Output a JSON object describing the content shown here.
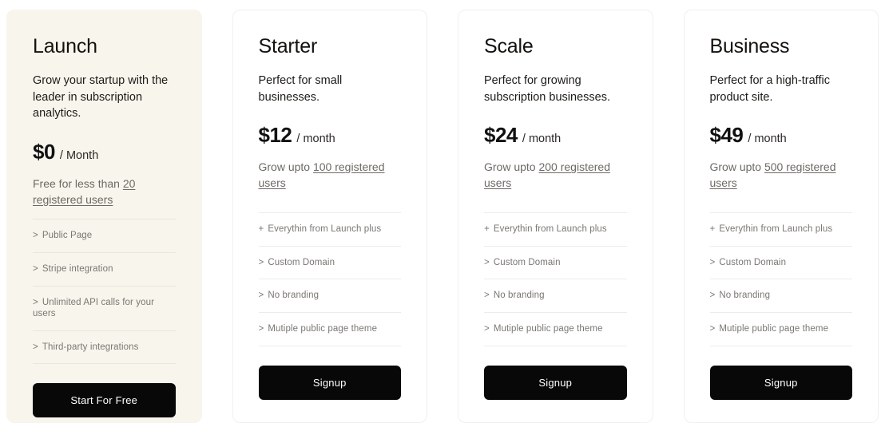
{
  "colors": {
    "page_background": "#ffffff",
    "featured_card_background": "#f8f5ed",
    "card_border": "#f0f0f0",
    "button_background": "#080808",
    "button_text": "#ffffff",
    "title_text": "#14110e",
    "muted_text": "#6d6a64",
    "feature_text": "#7a7772",
    "divider": "#e9e6df"
  },
  "plans": [
    {
      "id": "launch",
      "featured": true,
      "title": "Launch",
      "tagline": "Grow your startup with the leader in subscription analytics.",
      "price_amount": "$0",
      "price_period": "/ Month",
      "grow_prefix": "Free for less than ",
      "grow_link": "20 registered users",
      "features": [
        {
          "marker": ">",
          "label": "Public Page"
        },
        {
          "marker": ">",
          "label": "Stripe integration"
        },
        {
          "marker": ">",
          "label": "Unlimited API calls for your users"
        },
        {
          "marker": ">",
          "label": "Third-party integrations"
        }
      ],
      "cta_label": "Start For Free"
    },
    {
      "id": "starter",
      "featured": false,
      "title": "Starter",
      "tagline": "Perfect for small businesses.",
      "price_amount": "$12",
      "price_period": "/ month",
      "grow_prefix": "Grow upto ",
      "grow_link": "100 registered users",
      "features": [
        {
          "marker": "+",
          "label": "Everythin from Launch plus"
        },
        {
          "marker": ">",
          "label": "Custom Domain"
        },
        {
          "marker": ">",
          "label": "No branding"
        },
        {
          "marker": ">",
          "label": "Mutiple public page theme"
        }
      ],
      "cta_label": "Signup"
    },
    {
      "id": "scale",
      "featured": false,
      "title": "Scale",
      "tagline": "Perfect for growing subscription businesses.",
      "price_amount": "$24",
      "price_period": "/ month",
      "grow_prefix": "Grow upto ",
      "grow_link": "200 registered users",
      "features": [
        {
          "marker": "+",
          "label": "Everythin from Launch plus"
        },
        {
          "marker": ">",
          "label": "Custom Domain"
        },
        {
          "marker": ">",
          "label": "No branding"
        },
        {
          "marker": ">",
          "label": "Mutiple public page theme"
        }
      ],
      "cta_label": "Signup"
    },
    {
      "id": "business",
      "featured": false,
      "title": "Business",
      "tagline": "Perfect for a high-traffic product site.",
      "price_amount": "$49",
      "price_period": "/ month",
      "grow_prefix": "Grow upto ",
      "grow_link": "500 registered users",
      "features": [
        {
          "marker": "+",
          "label": "Everythin from Launch plus"
        },
        {
          "marker": ">",
          "label": "Custom Domain"
        },
        {
          "marker": ">",
          "label": "No branding"
        },
        {
          "marker": ">",
          "label": "Mutiple public page theme"
        }
      ],
      "cta_label": "Signup"
    }
  ]
}
